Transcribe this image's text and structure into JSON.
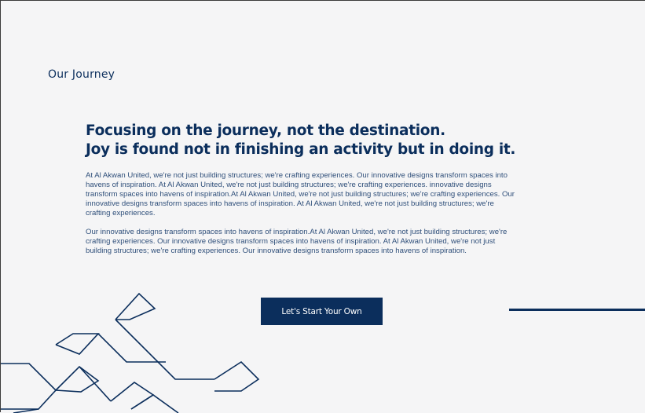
{
  "section": {
    "label": "Our Journey"
  },
  "heading": {
    "line1": "Focusing on the journey, not the destination.",
    "line2": "Joy is found not in finishing an activity but in doing it."
  },
  "paragraphs": [
    "At Al Akwan United, we're not just building structures; we're crafting experiences. Our innovative designs transform spaces into havens of inspiration.  At Al Akwan United, we're not just building structures; we're crafting experiences. innovative designs transform spaces into havens of inspiration.At Al Akwan United, we're not just building structures; we're crafting experiences. Our innovative designs transform spaces into havens of inspiration.  At Al Akwan United, we're not just building structures; we're crafting experiences.",
    "Our innovative designs transform spaces into havens of inspiration.At Al Akwan United, we're not just building structures; we're crafting experiences. Our innovative designs transform spaces into havens of inspiration. At Al Akwan United, we're not just building structures; we're crafting experiences. Our innovative designs transform spaces into havens of inspiration."
  ],
  "cta": {
    "label": "Let's Start Your Own"
  },
  "colors": {
    "brand_navy": "#0b2e5c",
    "background": "#f5f5f6"
  }
}
